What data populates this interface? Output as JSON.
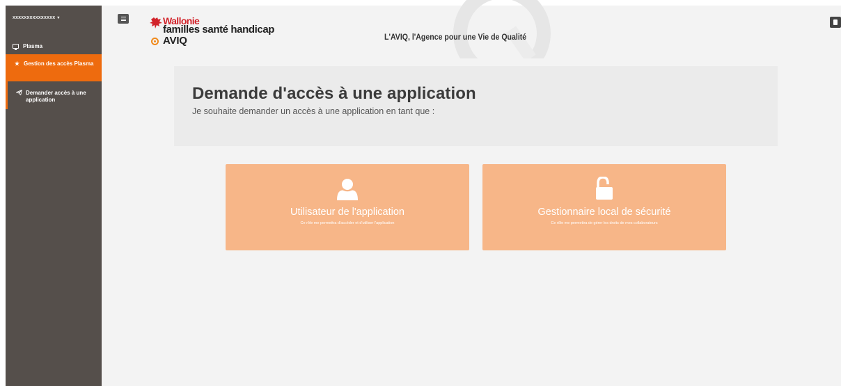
{
  "sidebar": {
    "user": "xxxxxxxxxxxxxxx",
    "items": [
      {
        "label": "Plasma",
        "icon": "monitor-icon"
      },
      {
        "label": "Gestion des accès Plasma",
        "icon": "star-icon",
        "active": true
      },
      {
        "label": "Demander accès à une application",
        "icon": "paper-plane-icon"
      }
    ]
  },
  "header": {
    "brand": {
      "wallonie": "Wallonie",
      "line2": "familles santé handicap",
      "aviq": "AVIQ"
    },
    "tagline": "L'AVIQ, l'Agence pour une Vie de Qualité"
  },
  "main": {
    "title": "Demande d'accès à une application",
    "subtitle": "Je souhaite demander un accès à une application en tant que :",
    "cards": [
      {
        "title": "Utilisateur de l'application",
        "description": "Ce rôle me permettra d'accéder et d'utiliser l'application",
        "icon": "user-icon"
      },
      {
        "title": "Gestionnaire local de sécurité",
        "description": "Ce rôle me permettra de gérer les droits de mes collaborateurs",
        "icon": "unlock-icon"
      }
    ]
  },
  "colors": {
    "sidebar_bg": "#554f4b",
    "active_item": "#ee6b0e",
    "card_bg": "#f7b688",
    "brand_red": "#d2232a",
    "aviq_orange": "#f08a1c"
  }
}
